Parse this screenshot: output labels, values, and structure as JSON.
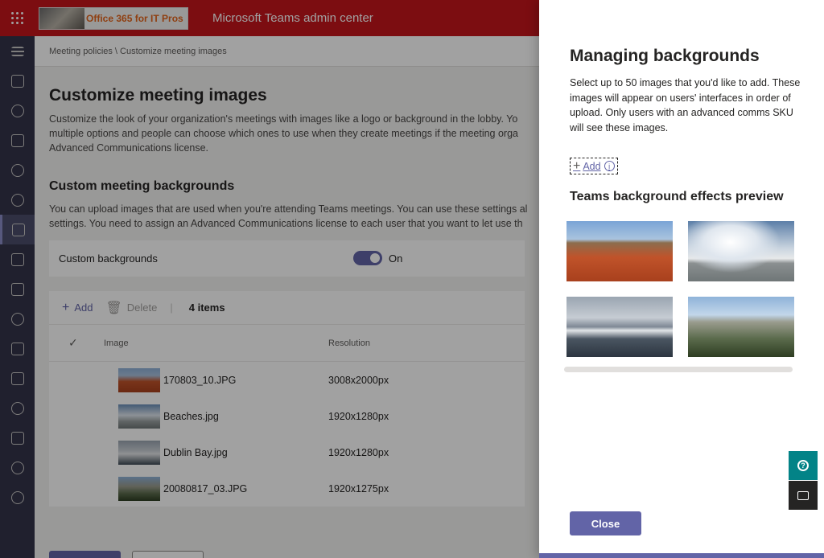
{
  "header": {
    "logo_text": "Office 365 for IT Pros",
    "app_title": "Microsoft Teams admin center"
  },
  "rail": {
    "icons": [
      "hamburger-menu-icon",
      "home-icon",
      "teams-icon",
      "deployment-icon",
      "locations-icon",
      "users-icon",
      "meetings-icon",
      "messaging-icon",
      "apps-icon",
      "voice-icon",
      "policy-packages-icon",
      "analytics-icon",
      "settings-icon",
      "planning-icon",
      "notifications-icon",
      "call-quality-icon"
    ],
    "active_index": 6
  },
  "breadcrumb": {
    "text": "Meeting policies \\ Customize meeting images"
  },
  "page": {
    "title": "Customize meeting images",
    "desc_line1": "Customize the look of your organization's meetings with images like a logo or background in the lobby. Yo",
    "desc_line2": "multiple options and people can choose which ones to use when they create meetings if the meeting orga",
    "desc_line3": "Advanced Communications license."
  },
  "section": {
    "title": "Custom meeting backgrounds",
    "desc_line1": "You can upload images that are used when you're attending Teams meetings. You can use these settings al",
    "desc_line2": "settings. You need to assign an Advanced Communications license to each user that you want to let use th"
  },
  "toggle": {
    "label": "Custom backgrounds",
    "state": "On",
    "on": true
  },
  "commands": {
    "add": "Add",
    "delete": "Delete",
    "count": "4 items"
  },
  "table": {
    "headers": [
      "Image",
      "Resolution"
    ],
    "rows": [
      {
        "name": "170803_10.JPG",
        "resolution": "3008x2000px"
      },
      {
        "name": "Beaches.jpg",
        "resolution": "1920x1280px"
      },
      {
        "name": "Dublin Bay.jpg",
        "resolution": "1920x1280px"
      },
      {
        "name": "20080817_03.JPG",
        "resolution": "1920x1275px"
      }
    ]
  },
  "panel": {
    "title": "Managing backgrounds",
    "description": "Select up to 50 images that you'd like to add. These images will appear on users' interfaces in order of upload. Only users with an advanced comms SKU will see these images.",
    "add_label": "Add",
    "preview_title": "Teams background effects preview",
    "close_label": "Close"
  },
  "colors": {
    "header_red": "#c4161c",
    "accent": "#6264a7",
    "rail": "#33344a",
    "help_teal": "#038387"
  }
}
